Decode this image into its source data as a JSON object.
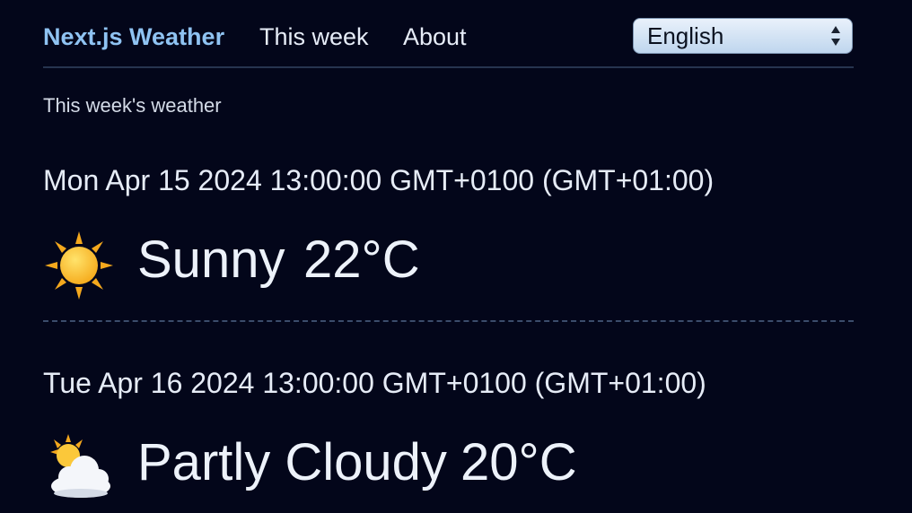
{
  "nav": {
    "brand": "Next.js Weather",
    "this_week": "This week",
    "about": "About"
  },
  "language_select": {
    "selected": "English"
  },
  "page": {
    "subtitle": "This week's weather"
  },
  "days": [
    {
      "date": "Mon Apr 15 2024 13:00:00 GMT+0100 (GMT+01:00)",
      "icon": "sun-icon",
      "condition": "Sunny",
      "temperature": "22°C"
    },
    {
      "date": "Tue Apr 16 2024 13:00:00 GMT+0100 (GMT+01:00)",
      "icon": "partly-cloudy-icon",
      "condition": "Partly Cloudy",
      "temperature": "20°C"
    }
  ],
  "colors": {
    "background": "#03061a",
    "brand": "#8fc3f2",
    "text": "#e6ecf7",
    "divider": "#3b4c6b"
  }
}
